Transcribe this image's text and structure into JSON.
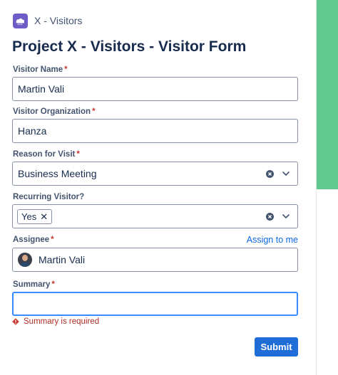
{
  "app": {
    "title": "X - Visitors"
  },
  "form": {
    "title": "Project X - Visitors - Visitor Form",
    "required_marker": "*",
    "fields": {
      "visitor_name": {
        "label": "Visitor Name",
        "value": "Martin Vali"
      },
      "visitor_organization": {
        "label": "Visitor Organization",
        "value": "Hanza"
      },
      "reason": {
        "label": "Reason for Visit",
        "value": "Business Meeting"
      },
      "recurring": {
        "label": "Recurring Visitor?",
        "tag": "Yes",
        "tag_remove": "✕"
      },
      "assignee": {
        "label": "Assignee",
        "value": "Martin Vali",
        "assign_link": "Assign to me"
      },
      "summary": {
        "label": "Summary",
        "value": "",
        "error": "Summary is required"
      }
    },
    "submit_label": "Submit"
  },
  "colors": {
    "accent": "#1f6dd6",
    "error": "#ae2e24",
    "side_panel": "#5fc98f",
    "app_icon": "#6e5dc6"
  }
}
